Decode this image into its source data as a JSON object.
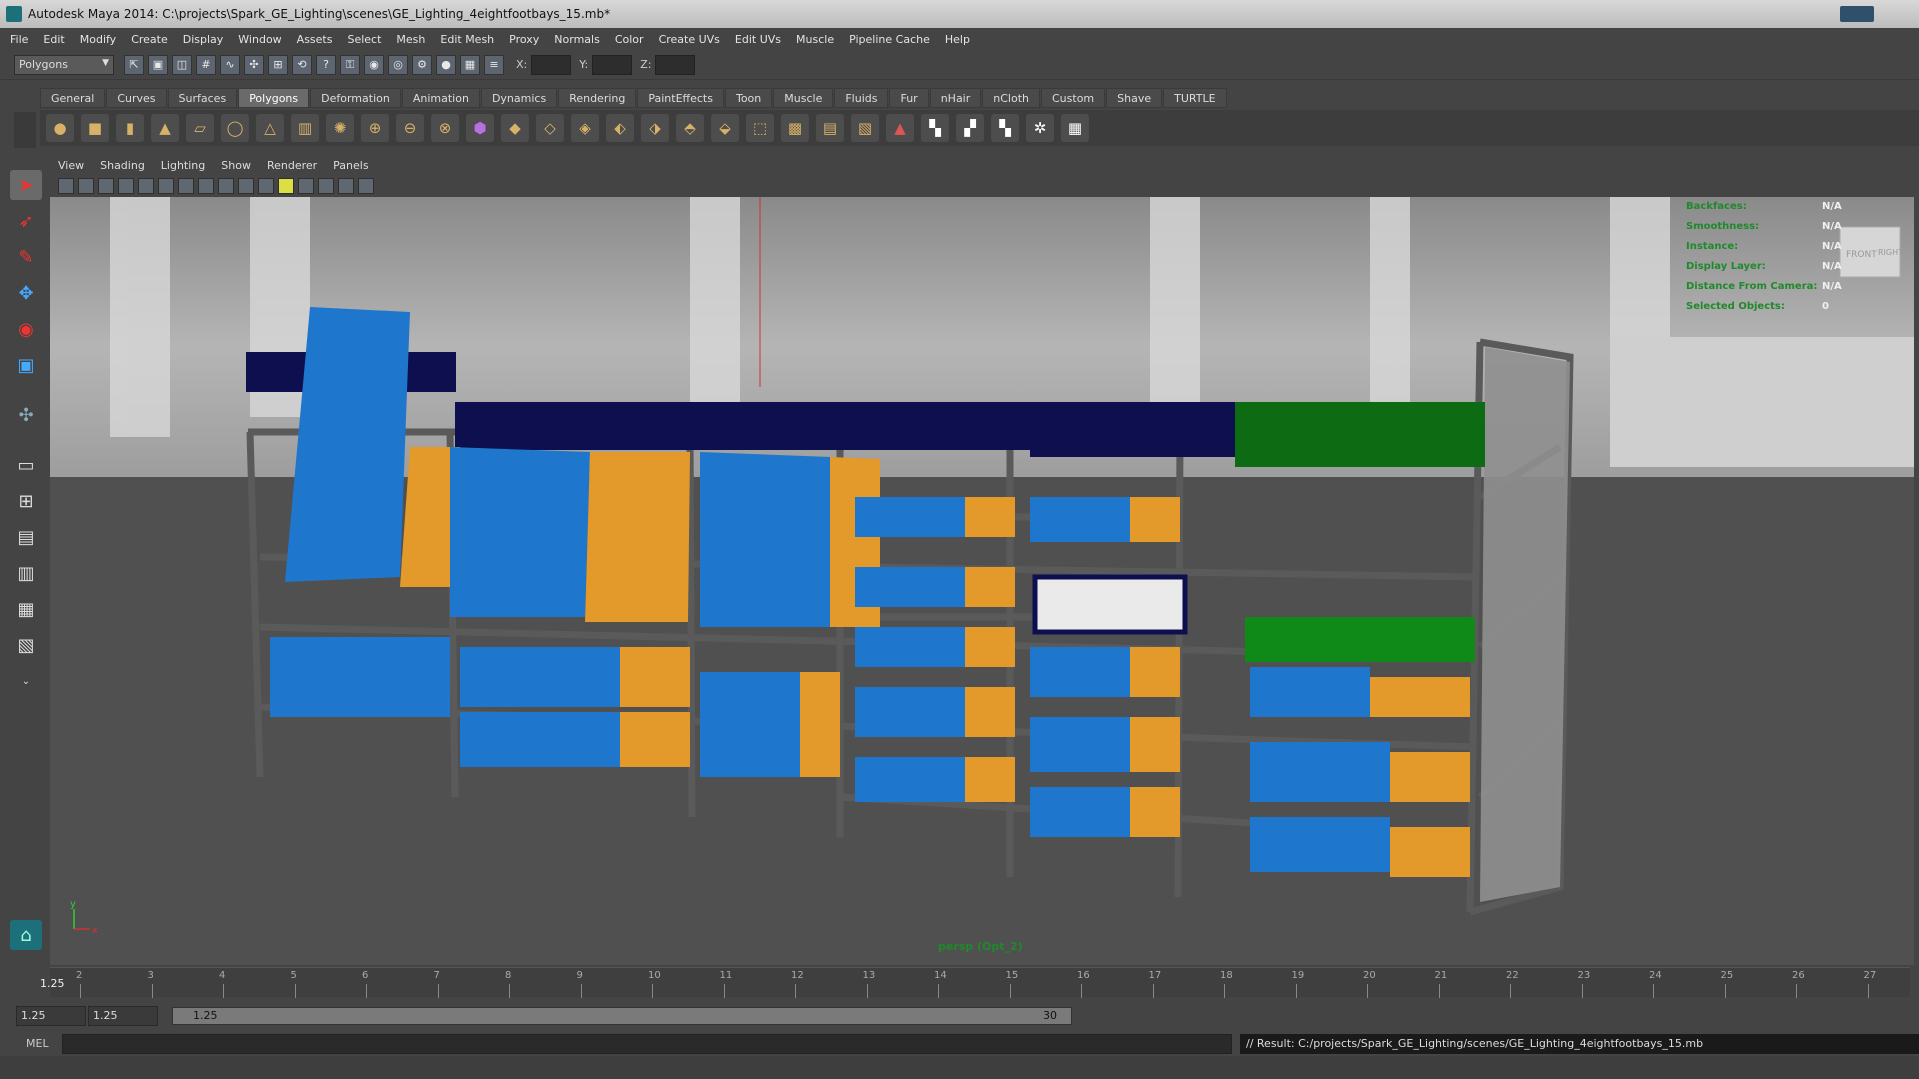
{
  "window": {
    "title": "Autodesk Maya 2014: C:\\projects\\Spark_GE_Lighting\\scenes\\GE_Lighting_4eightfootbays_15.mb*"
  },
  "menu": [
    "File",
    "Edit",
    "Modify",
    "Create",
    "Display",
    "Window",
    "Assets",
    "Select",
    "Mesh",
    "Edit Mesh",
    "Proxy",
    "Normals",
    "Color",
    "Create UVs",
    "Edit UVs",
    "Muscle",
    "Pipeline Cache",
    "Help"
  ],
  "status_line": {
    "mode": "Polygons",
    "x_label": "X:",
    "y_label": "Y:",
    "z_label": "Z:"
  },
  "shelf_tabs": [
    "General",
    "Curves",
    "Surfaces",
    "Polygons",
    "Deformation",
    "Animation",
    "Dynamics",
    "Rendering",
    "PaintEffects",
    "Toon",
    "Muscle",
    "Fluids",
    "Fur",
    "nHair",
    "nCloth",
    "Custom",
    "Shave",
    "TURTLE"
  ],
  "active_shelf": "Polygons",
  "panel_menu": [
    "View",
    "Shading",
    "Lighting",
    "Show",
    "Renderer",
    "Panels"
  ],
  "hud": [
    {
      "label": "Backfaces:",
      "value": "N/A"
    },
    {
      "label": "Smoothness:",
      "value": "N/A"
    },
    {
      "label": "Instance:",
      "value": "N/A"
    },
    {
      "label": "Display Layer:",
      "value": "N/A"
    },
    {
      "label": "Distance From Camera:",
      "value": "N/A"
    },
    {
      "label": "Selected Objects:",
      "value": "0"
    }
  ],
  "view_cube": {
    "front": "FRONT",
    "right": "RIGHT"
  },
  "axis": {
    "x": "x",
    "y": "y"
  },
  "camera_label": "persp (Opt_2)",
  "timeline": {
    "current_frame": "1.25",
    "ticks": [
      "2",
      "3",
      "4",
      "5",
      "6",
      "7",
      "8",
      "9",
      "10",
      "11",
      "12",
      "13",
      "14",
      "15",
      "16",
      "17",
      "18",
      "19",
      "20",
      "21",
      "22",
      "23",
      "24",
      "25",
      "26",
      "27"
    ]
  },
  "range": {
    "start": "1.25",
    "playback_start": "1.25",
    "slider_start": "1.25",
    "slider_end": "30"
  },
  "command_line": {
    "label": "MEL",
    "result": "// Result: C:/projects/Spark_GE_Lighting/scenes/GE_Lighting_4eightfootbays_15.mb"
  },
  "colors": {
    "hud_green": "#1f8a2a",
    "shelf_navy": "#0d0f4e",
    "shelf_green": "#0d6b14",
    "box_blue": "#1e77cc",
    "box_orange": "#e39a2a"
  }
}
